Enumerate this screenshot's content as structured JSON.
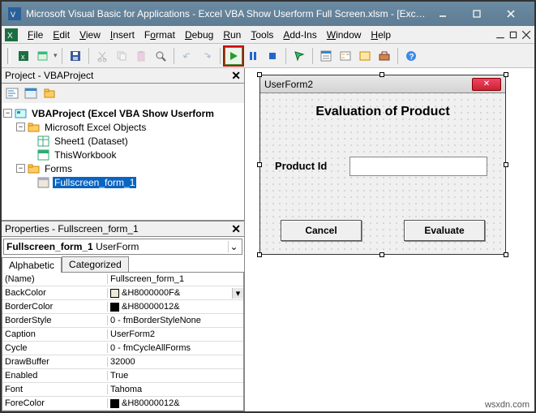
{
  "title": "Microsoft Visual Basic for Applications - Excel VBA Show Userform Full Screen.xlsm - [Exce...",
  "menu": [
    "File",
    "Edit",
    "View",
    "Insert",
    "Format",
    "Debug",
    "Run",
    "Tools",
    "Add-Ins",
    "Window",
    "Help"
  ],
  "project": {
    "header": "Project - VBAProject",
    "root": "VBAProject (Excel VBA Show Userform",
    "excelObjects": "Microsoft Excel Objects",
    "sheet1": "Sheet1 (Dataset)",
    "thisWorkbook": "ThisWorkbook",
    "forms": "Forms",
    "form1": "Fullscreen_form_1"
  },
  "properties": {
    "header": "Properties - Fullscreen_form_1",
    "objectName": "Fullscreen_form_1",
    "objectType": "UserForm",
    "tabs": {
      "a": "Alphabetic",
      "c": "Categorized"
    },
    "rows": [
      {
        "k": "(Name)",
        "v": "Fullscreen_form_1"
      },
      {
        "k": "BackColor",
        "v": "&H8000000F&",
        "swatch": "#ece9d8",
        "drop": true
      },
      {
        "k": "BorderColor",
        "v": "&H80000012&",
        "swatch": "#000000"
      },
      {
        "k": "BorderStyle",
        "v": "0 - fmBorderStyleNone"
      },
      {
        "k": "Caption",
        "v": "UserForm2"
      },
      {
        "k": "Cycle",
        "v": "0 - fmCycleAllForms"
      },
      {
        "k": "DrawBuffer",
        "v": "32000"
      },
      {
        "k": "Enabled",
        "v": "True"
      },
      {
        "k": "Font",
        "v": "Tahoma"
      },
      {
        "k": "ForeColor",
        "v": "&H80000012&",
        "swatch": "#000000"
      }
    ]
  },
  "userform": {
    "caption": "UserForm2",
    "title": "Evaluation of Product",
    "label": "Product Id",
    "cancel": "Cancel",
    "evaluate": "Evaluate"
  },
  "watermark": "wsxdn.com"
}
